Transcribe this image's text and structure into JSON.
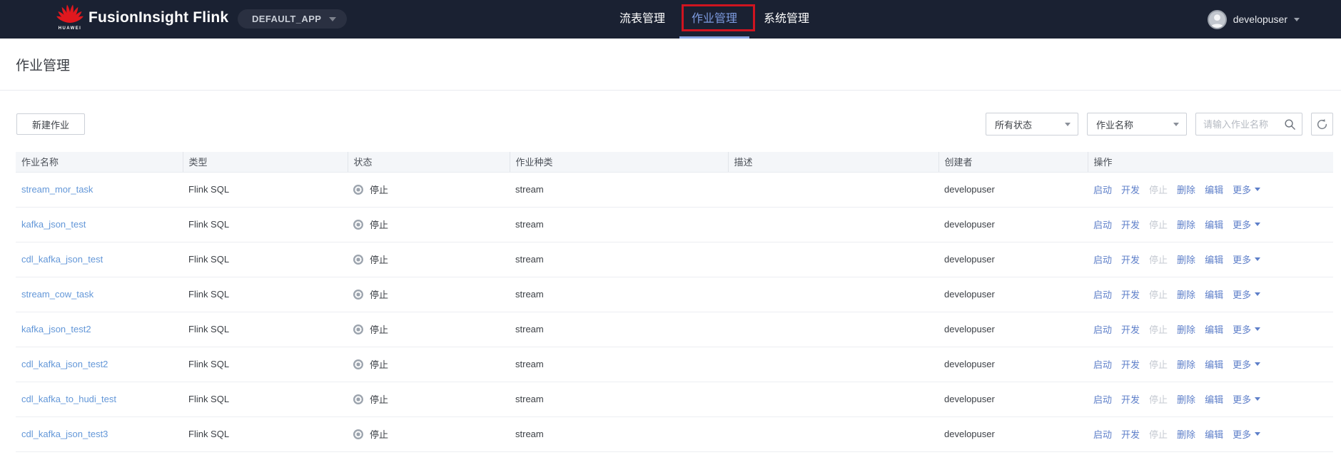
{
  "navbar": {
    "logo_word": "HUAWEI",
    "brand": "FusionInsight Flink",
    "app_selector": "DEFAULT_APP",
    "items": [
      {
        "label": "流表管理",
        "active": false
      },
      {
        "label": "作业管理",
        "active": true
      },
      {
        "label": "系统管理",
        "active": false
      }
    ],
    "user": "developuser"
  },
  "page": {
    "title": "作业管理"
  },
  "toolbar": {
    "new_job_label": "新建作业",
    "status_filter_value": "所有状态",
    "field_filter_value": "作业名称",
    "search_placeholder": "请输入作业名称"
  },
  "table": {
    "columns": [
      "作业名称",
      "类型",
      "状态",
      "作业种类",
      "描述",
      "创建者",
      "操作"
    ],
    "actions": {
      "start": "启动",
      "develop": "开发",
      "stop": "停止",
      "delete": "删除",
      "edit": "编辑",
      "more": "更多"
    },
    "rows": [
      {
        "name": "stream_mor_task",
        "type": "Flink SQL",
        "status": "停止",
        "kind": "stream",
        "description": "",
        "creator": "developuser"
      },
      {
        "name": "kafka_json_test",
        "type": "Flink SQL",
        "status": "停止",
        "kind": "stream",
        "description": "",
        "creator": "developuser"
      },
      {
        "name": "cdl_kafka_json_test",
        "type": "Flink SQL",
        "status": "停止",
        "kind": "stream",
        "description": "",
        "creator": "developuser"
      },
      {
        "name": "stream_cow_task",
        "type": "Flink SQL",
        "status": "停止",
        "kind": "stream",
        "description": "",
        "creator": "developuser"
      },
      {
        "name": "kafka_json_test2",
        "type": "Flink SQL",
        "status": "停止",
        "kind": "stream",
        "description": "",
        "creator": "developuser"
      },
      {
        "name": "cdl_kafka_json_test2",
        "type": "Flink SQL",
        "status": "停止",
        "kind": "stream",
        "description": "",
        "creator": "developuser"
      },
      {
        "name": "cdl_kafka_to_hudi_test",
        "type": "Flink SQL",
        "status": "停止",
        "kind": "stream",
        "description": "",
        "creator": "developuser"
      },
      {
        "name": "cdl_kafka_json_test3",
        "type": "Flink SQL",
        "status": "停止",
        "kind": "stream",
        "description": "",
        "creator": "developuser"
      }
    ]
  },
  "colors": {
    "navbar_bg": "#1a2132",
    "active_tab_text": "#7d9be0",
    "active_tab_underline": "#8aa6e4",
    "annotation_red": "#cf1420",
    "job_link_blue": "#6397d8",
    "action_link_blue": "#5e7fc9",
    "action_disabled": "#c5cad2",
    "status_stopped_gray": "#9ba3ad",
    "huawei_logo_red": "#e0181e"
  }
}
